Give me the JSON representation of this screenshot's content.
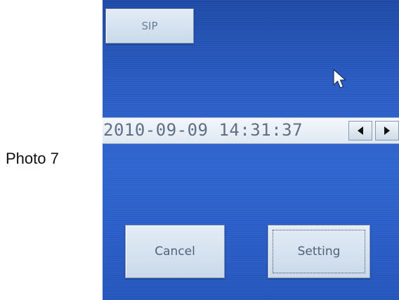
{
  "caption": "Photo 7",
  "toolbar": {
    "sip_label": "SIP"
  },
  "datetime": {
    "value": "2010-09-09 14:31:37"
  },
  "actions": {
    "cancel_label": "Cancel",
    "setting_label": "Setting"
  },
  "icons": {
    "cursor": "mouse-pointer-icon",
    "left": "left-arrow-icon",
    "right": "right-arrow-icon"
  },
  "colors": {
    "screen_blue": "#2b5cc4",
    "button_face": "#d6e2ef",
    "text_gray": "#5f6f86"
  }
}
